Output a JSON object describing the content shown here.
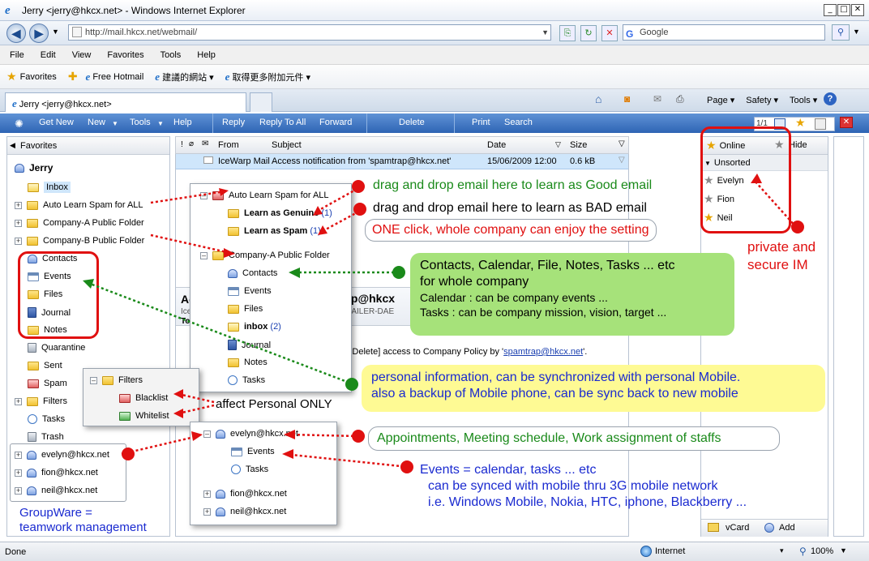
{
  "browser": {
    "title": "Jerry <jerry@hkcx.net> - Windows Internet Explorer",
    "url": "http://mail.hkcx.net/webmail/",
    "search_placeholder": "Google",
    "menu": [
      "File",
      "Edit",
      "View",
      "Favorites",
      "Tools",
      "Help"
    ],
    "favorites_label": "Favorites",
    "fav_links": [
      "Free Hotmail",
      "建議的網站 ▾",
      "取得更多附加元件 ▾"
    ],
    "tab_title": "Jerry <jerry@hkcx.net>",
    "commands": [
      "Page ▾",
      "Safety ▾",
      "Tools ▾"
    ],
    "status": "Done",
    "zone": "Internet",
    "zoom": "100%"
  },
  "toolbar": {
    "get_new": "Get New",
    "new": "New",
    "tools": "Tools",
    "help": "Help",
    "reply": "Reply",
    "reply_all": "Reply To All",
    "forward": "Forward",
    "delete": "Delete",
    "print": "Print",
    "search": "Search",
    "page_count": "1/1"
  },
  "favorites_pane": {
    "header": "Favorites",
    "user": "Jerry",
    "folders": [
      "Inbox",
      "Auto Learn Spam for ALL",
      "Company-A Public Folder",
      "Company-B Public Folder",
      "Contacts",
      "Events",
      "Files",
      "Journal",
      "Notes",
      "Quarantine",
      "Sent",
      "Spam",
      "Filters",
      "Tasks",
      "Trash"
    ],
    "shared_users": [
      "evelyn@hkcx.net",
      "fion@hkcx.net",
      "neil@hkcx.net"
    ]
  },
  "message_list": {
    "columns": [
      "From",
      "Subject",
      "Date",
      "Size"
    ],
    "rows": [
      {
        "from": "IceWarp Mail",
        "subject": "Access notification from 'spamtrap@hkcx.net'",
        "date": "15/06/2009 12:00",
        "size": "0.6 kB"
      }
    ]
  },
  "reading_pane": {
    "title_fragment": "Ac",
    "title_fragment2": "trap@hkcx",
    "sub1": "Ice",
    "sub2": "P-MAILER-DAE",
    "to": "To",
    "body_prefix": "dify, Delete] access to Company Policy by '",
    "body_link": "spamtrap@hkcx.net",
    "body_suffix": "'."
  },
  "im_pane": {
    "online": "Online",
    "hide": "Hide",
    "group": "Unsorted",
    "contacts": [
      "Evelyn",
      "Fion",
      "Neil"
    ],
    "vcard": "vCard",
    "add": "Add"
  },
  "popup_spam": {
    "root": "Auto Learn Spam for ALL",
    "genuine": "Learn as Genuine",
    "genuine_count": "(1)",
    "spam": "Learn as Spam",
    "spam_count": "(1)",
    "company": "Company-A Public Folder",
    "items": [
      "Contacts",
      "Events",
      "Files"
    ],
    "inbox": "inbox",
    "inbox_count": "(2)",
    "items2": [
      "Journal",
      "Notes",
      "Tasks"
    ]
  },
  "popup_filters": {
    "root": "Filters",
    "items": [
      "Blacklist",
      "Whitelist"
    ]
  },
  "popup_users": {
    "user1": "evelyn@hkcx.net",
    "items": [
      "Events",
      "Tasks"
    ],
    "user2": "fion@hkcx.net",
    "user3": "neil@hkcx.net"
  },
  "annotations": {
    "good": "drag and drop email here to learn as Good email",
    "bad": "drag and drop email here to learn as BAD email",
    "one_click": "ONE click, whole company can enjoy the setting",
    "private_im": "private and\nsecure IM",
    "company_line1": "Contacts, Calendar, File, Notes, Tasks ... etc",
    "company_line2": "for whole company",
    "company_line3": "Calendar : can be company events ...",
    "company_line4": "Tasks : can be company mission, vision, target ...",
    "personal_line1": "personal information, can be synchronized with personal Mobile.",
    "personal_line2": "also a backup of Mobile phone, can be sync back to new mobile",
    "affect_personal": "affect Personal ONLY",
    "appointments": "Appointments, Meeting schedule, Work assignment of staffs",
    "events_line1": "Events = calendar, tasks ... etc",
    "events_line2": "can be synced with mobile thru 3G mobile network",
    "events_line3": "i.e. Windows Mobile, Nokia, HTC, iphone, Blackberry ...",
    "groupware1": "GroupWare =",
    "groupware2": "teamwork management"
  }
}
